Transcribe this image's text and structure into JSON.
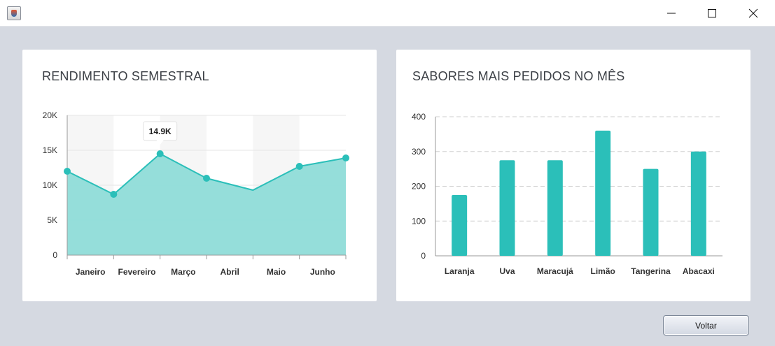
{
  "window": {
    "minimize_icon": "minimize-icon",
    "maximize_icon": "maximize-icon",
    "close_icon": "close-icon"
  },
  "colors": {
    "accent": "#2bbfb9",
    "area_fill": "#8fdcd8",
    "background": "#d5d9e1",
    "card": "#ffffff",
    "text": "#3b3f45"
  },
  "left_card": {
    "title": "RENDIMENTO SEMESTRAL"
  },
  "right_card": {
    "title": "SABORES MAIS PEDIDOS NO MÊS"
  },
  "footer": {
    "voltar_label": "Voltar"
  },
  "chart_data": [
    {
      "type": "area",
      "title": "RENDIMENTO SEMESTRAL",
      "categories": [
        "Janeiro",
        "Fevereiro",
        "Março",
        "Abril",
        "Maio",
        "Junho"
      ],
      "values": [
        12000,
        8700,
        14500,
        11000,
        9300,
        12700,
        13900
      ],
      "ylim": [
        0,
        20000
      ],
      "yticks": [
        "0",
        "5K",
        "10K",
        "15K",
        "20K"
      ],
      "tooltip": "14.9K",
      "grid": true,
      "legend": "none"
    },
    {
      "type": "bar",
      "title": "SABORES MAIS PEDIDOS NO MÊS",
      "categories": [
        "Laranja",
        "Uva",
        "Maracujá",
        "Limão",
        "Tangerina",
        "Abacaxi"
      ],
      "values": [
        175,
        275,
        275,
        360,
        250,
        300
      ],
      "ylim": [
        0,
        400
      ],
      "yticks": [
        "0",
        "100",
        "200",
        "300",
        "400"
      ],
      "grid": true,
      "legend": "none"
    }
  ]
}
